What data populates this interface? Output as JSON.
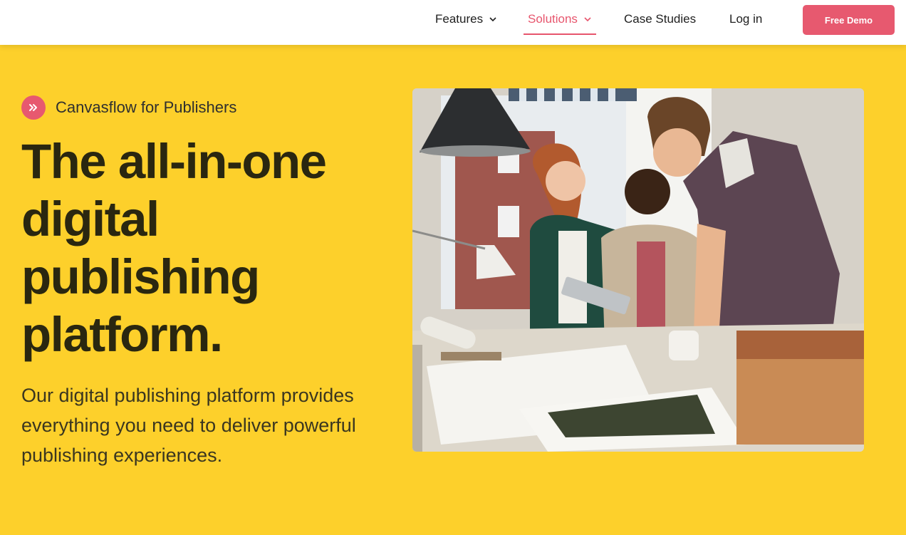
{
  "nav": {
    "items": [
      {
        "label": "Features",
        "has_dropdown": true
      },
      {
        "label": "Solutions",
        "has_dropdown": true,
        "active": true
      },
      {
        "label": "Case Studies",
        "has_dropdown": false
      },
      {
        "label": "Log in",
        "has_dropdown": false
      }
    ],
    "cta_label": "Free Demo"
  },
  "hero": {
    "eyebrow_icon": "double-chevron-right-icon",
    "eyebrow": "Canvasflow for Publishers",
    "headline_lines": [
      "The all-in-one",
      "digital",
      "publishing",
      "platform."
    ],
    "subtext": "Our digital publishing platform provides everything you need to deliver powerful publishing experiences.",
    "image_icon": "team-at-desk-photo"
  },
  "colors": {
    "background": "#fdd02b",
    "accent": "#e7596f",
    "headline": "#2a2710",
    "nav_bg": "#ffffff"
  }
}
